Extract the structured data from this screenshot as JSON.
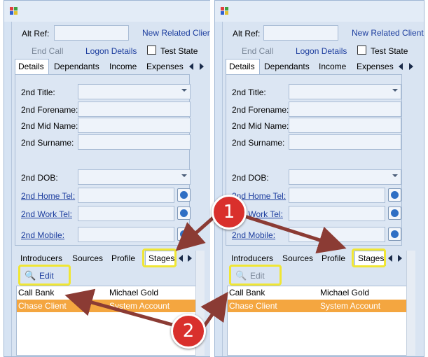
{
  "form": {
    "alt_ref_label": "Alt Ref:",
    "alt_ref_value": "",
    "new_related_client": "New Related Client",
    "end_call": "End Call",
    "logon_details": "Logon Details",
    "test_state": "Test State"
  },
  "top_tabs": [
    "Details",
    "Dependants",
    "Income",
    "Expenses"
  ],
  "fields": {
    "title": "2nd Title:",
    "forename": "2nd Forename:",
    "mid_name": "2nd Mid Name:",
    "surname": "2nd Surname:",
    "dob": "2nd DOB:",
    "home_tel": "2nd Home Tel:",
    "work_tel": "2nd Work Tel:",
    "mobile": "2nd Mobile:"
  },
  "bottom_tabs": [
    "Introducers",
    "Sources",
    "Profile",
    "Stages"
  ],
  "edit_label": "Edit",
  "grid_rows": [
    {
      "name": "Call Bank",
      "account": "Michael Gold"
    },
    {
      "name": "Chase Client",
      "account": "System Account"
    }
  ],
  "annotations": {
    "one": "1",
    "two": "2"
  },
  "colors": {
    "highlight": "#f0e634",
    "selected_row": "#f4a640",
    "annotation_marker": "#d9302c",
    "arrow": "#8b3b34"
  }
}
